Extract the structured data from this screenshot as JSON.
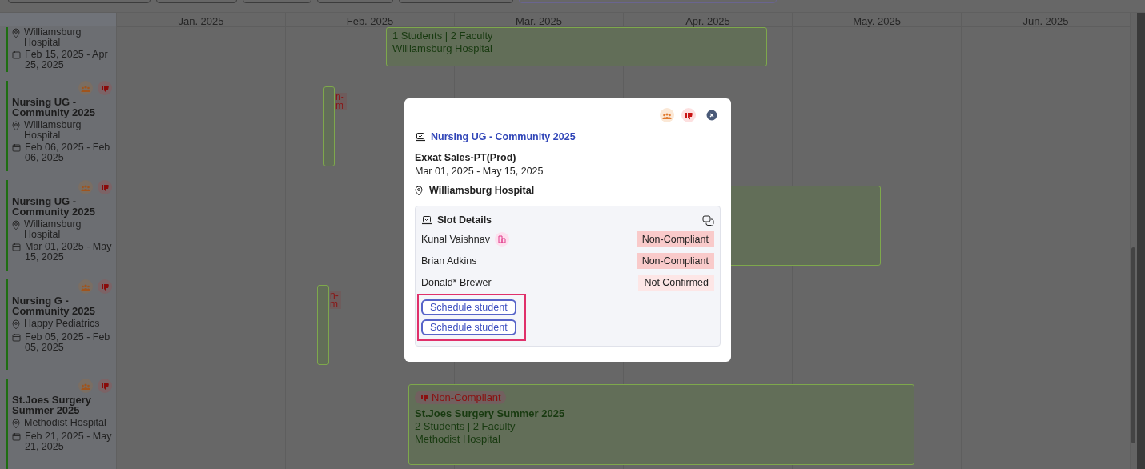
{
  "toolbar_buttons": [
    {
      "kind": "plain"
    },
    {
      "kind": "plain"
    },
    {
      "kind": "plain"
    },
    {
      "kind": "plain"
    },
    {
      "kind": "plain"
    },
    {
      "kind": "accent"
    }
  ],
  "calendar": {
    "months": [
      "Jan. 2025",
      "Feb. 2025",
      "Mar. 2025",
      "Apr. 2025",
      "May. 2025",
      "Jun. 2025"
    ]
  },
  "placements": [
    {
      "location": "Williamsburg Hospital",
      "dates": "Feb 15, 2025 - Apr 25, 2025"
    },
    {
      "title": "Nursing UG - Community 2025",
      "location": "Williamsburg Hospital",
      "dates": "Feb 06, 2025 - Feb 06, 2025"
    },
    {
      "title": "Nursing UG - Community 2025",
      "location": "Williamsburg Hospital",
      "dates": "Mar 01, 2025 - May 15, 2025"
    },
    {
      "title": "Nursing G - Community 2025",
      "location": "Happy Pediatrics",
      "dates": "Feb 05, 2025 - Feb 05, 2025"
    },
    {
      "title": "St.Joes Surgery Summer 2025",
      "location": "Methodist Hospital",
      "dates": "Feb 21, 2025 - May 21, 2025"
    }
  ],
  "timeline_bars": [
    {
      "kind": "wide",
      "counts": "1 Students | 2 Faculty",
      "location": "Williamsburg Hospital"
    },
    {
      "kind": "narrow",
      "tag": "n- m"
    },
    {
      "kind": "wide"
    },
    {
      "kind": "narrow",
      "tag": "n- m"
    },
    {
      "kind": "wide",
      "tag": "Non-Compliant",
      "title": "St.Joes Surgery Summer 2025",
      "counts": "2 Students | 2 Faculty",
      "location": "Methodist Hospital"
    }
  ],
  "dialog": {
    "program": "Nursing UG - Community 2025",
    "school": "Exxat Sales-PT(Prod)",
    "dates": "Mar 01, 2025 - May 15, 2025",
    "location": "Williamsburg Hospital",
    "slot_details": {
      "title": "Slot Details",
      "students": [
        {
          "name": "Kunal Vaishnav",
          "flagged": true,
          "status": "Non-Compliant",
          "kind": "noncompliant"
        },
        {
          "name": "Brian Adkins",
          "flagged": false,
          "status": "Non-Compliant",
          "kind": "noncompliant"
        },
        {
          "name": "Donald* Brewer",
          "flagged": false,
          "status": "Not Confirmed",
          "kind": "unconfirmed"
        }
      ],
      "actions": [
        "Schedule student",
        "Schedule student"
      ]
    }
  }
}
